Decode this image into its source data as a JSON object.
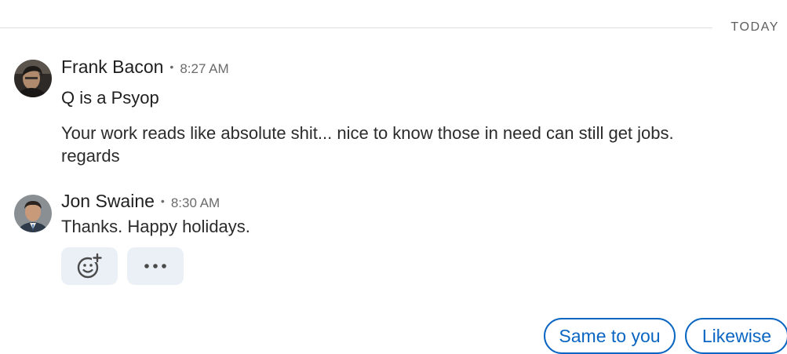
{
  "divider": {
    "label": "TODAY"
  },
  "messages": [
    {
      "sender": "Frank Bacon",
      "separator": "•",
      "time": "8:27 AM",
      "subject": "Q is a Psyop",
      "body_lines": [
        "Your work reads like absolute shit... nice to know those in need can still get jobs.",
        "regards"
      ]
    },
    {
      "sender": "Jon Swaine",
      "separator": "•",
      "time": "8:30 AM",
      "body_lines": [
        "Thanks. Happy holidays."
      ]
    }
  ],
  "actions": {
    "react_icon": "add-reaction-icon",
    "more_icon": "more-icon"
  },
  "quick_replies": [
    "Same to you",
    "Likewise"
  ],
  "colors": {
    "accent": "#0a66c2",
    "action_bg": "#eaf0f6"
  }
}
